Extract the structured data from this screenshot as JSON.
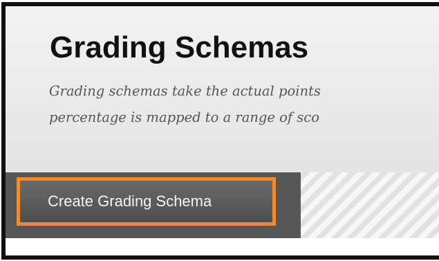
{
  "header": {
    "title": "Grading Schemas",
    "description_line_1": "Grading schemas take the actual points",
    "description_line_2": "percentage is mapped to a range of sco"
  },
  "action_bar": {
    "create_button_label": "Create Grading Schema",
    "highlight_color": "#f28a2e"
  }
}
